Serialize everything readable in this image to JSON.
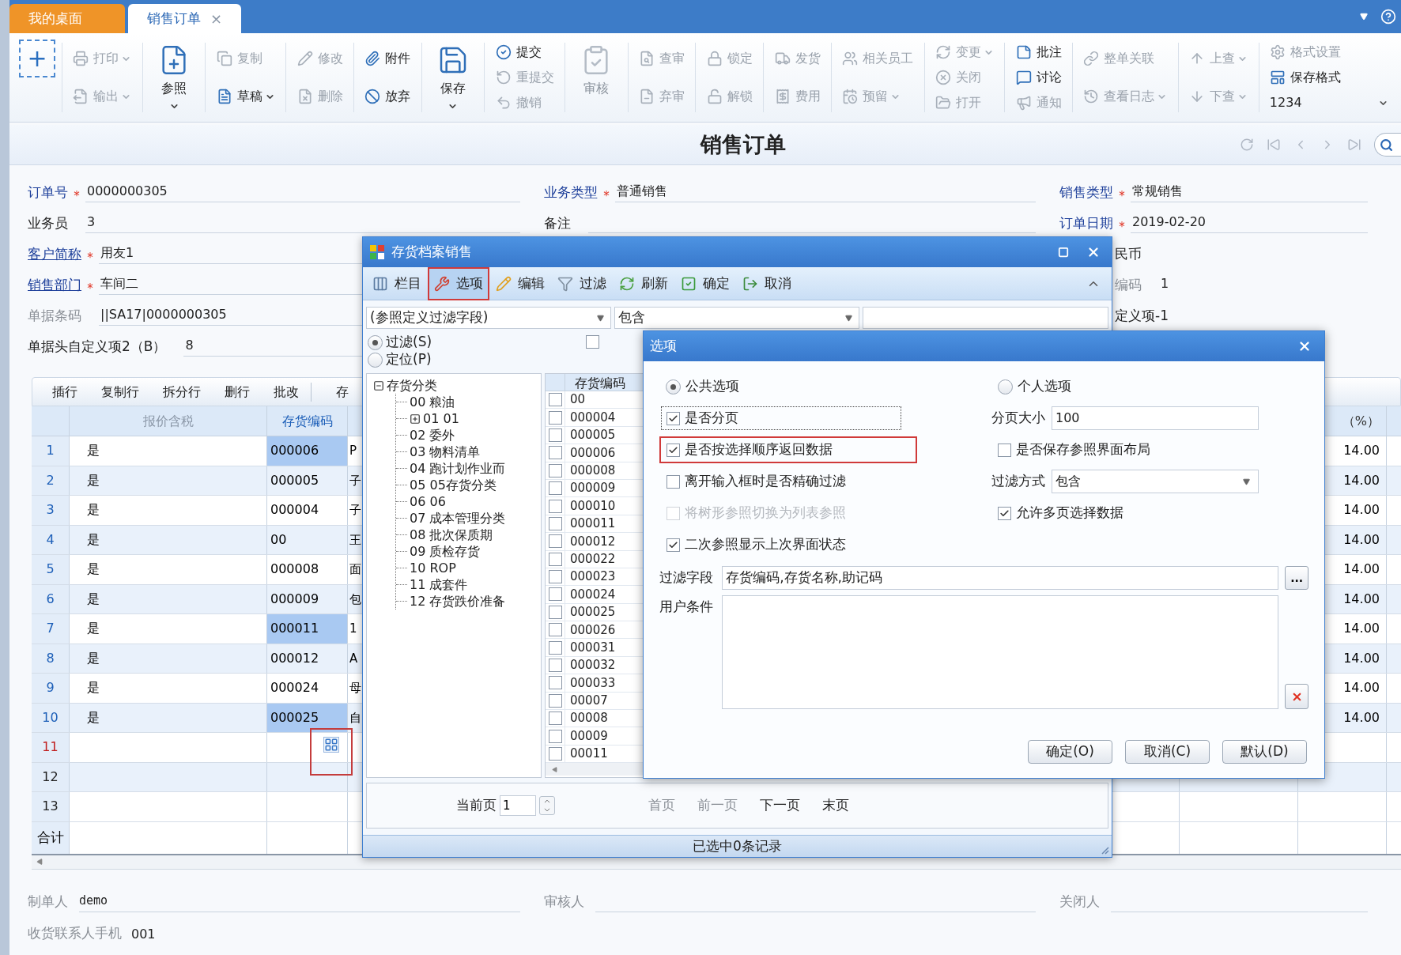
{
  "app_tabs": [
    {
      "label": "我的桌面",
      "selected": false
    },
    {
      "label": "销售订单",
      "selected": true,
      "close": "×"
    }
  ],
  "toolbar": {
    "add": "+",
    "columns": [
      {
        "kind": "stack",
        "items": [
          {
            "label": "打印",
            "disabled": true,
            "dropdown": true
          },
          {
            "label": "输出",
            "disabled": true,
            "dropdown": true
          }
        ]
      },
      {
        "kind": "large",
        "items": [
          {
            "label": "参照",
            "disabled": false,
            "dropdown": true
          }
        ]
      },
      {
        "kind": "stack",
        "items": [
          {
            "label": "复制",
            "disabled": true,
            "dropdown": false
          },
          {
            "label": "草稿",
            "disabled": false,
            "dropdown": true
          }
        ]
      },
      {
        "kind": "stack",
        "items": [
          {
            "label": "修改",
            "disabled": true,
            "dropdown": false
          },
          {
            "label": "删除",
            "disabled": true,
            "dropdown": false
          }
        ]
      },
      {
        "kind": "stack",
        "items": [
          {
            "label": "附件",
            "disabled": false,
            "dropdown": false
          },
          {
            "label": "放弃",
            "disabled": false,
            "dropdown": false
          }
        ]
      },
      {
        "kind": "large",
        "items": [
          {
            "label": "保存",
            "disabled": false,
            "dropdown": true
          }
        ]
      },
      {
        "kind": "stack",
        "items": [
          {
            "label": "提交",
            "disabled": false,
            "dropdown": false
          },
          {
            "label": "重提交",
            "disabled": true,
            "dropdown": false
          },
          {
            "label": "撤销",
            "disabled": true,
            "dropdown": false
          }
        ]
      },
      {
        "kind": "large",
        "items": [
          {
            "label": "审核",
            "disabled": true,
            "dropdown": false
          }
        ]
      },
      {
        "kind": "stack",
        "items": [
          {
            "label": "查审",
            "disabled": true,
            "dropdown": false
          },
          {
            "label": "弃审",
            "disabled": true,
            "dropdown": false
          }
        ]
      },
      {
        "kind": "stack",
        "items": [
          {
            "label": "锁定",
            "disabled": true,
            "dropdown": false
          },
          {
            "label": "解锁",
            "disabled": true,
            "dropdown": false
          }
        ]
      },
      {
        "kind": "stack",
        "items": [
          {
            "label": "发货",
            "disabled": true,
            "dropdown": false
          },
          {
            "label": "费用",
            "disabled": true,
            "dropdown": false
          }
        ]
      },
      {
        "kind": "stack",
        "items": [
          {
            "label": "相关员工",
            "disabled": true,
            "dropdown": false
          },
          {
            "label": "预留",
            "disabled": true,
            "dropdown": true
          }
        ]
      },
      {
        "kind": "stack",
        "items": [
          {
            "label": "变更",
            "disabled": true,
            "dropdown": true
          },
          {
            "label": "关闭",
            "disabled": true,
            "dropdown": false
          },
          {
            "label": "打开",
            "disabled": true,
            "dropdown": false
          }
        ]
      },
      {
        "kind": "stack",
        "items": [
          {
            "label": "批注",
            "disabled": false,
            "dropdown": false
          },
          {
            "label": "讨论",
            "disabled": false,
            "dropdown": false
          },
          {
            "label": "通知",
            "disabled": true,
            "dropdown": false
          }
        ]
      },
      {
        "kind": "stack",
        "items": [
          {
            "label": "整单关联",
            "disabled": true,
            "dropdown": false
          },
          {
            "label": "查看日志",
            "disabled": true,
            "dropdown": true
          }
        ]
      },
      {
        "kind": "stack",
        "items": [
          {
            "label": "上查",
            "disabled": true,
            "dropdown": true
          },
          {
            "label": "下查",
            "disabled": true,
            "dropdown": true
          }
        ]
      },
      {
        "kind": "stack",
        "items": [
          {
            "label": "格式设置",
            "disabled": true,
            "dropdown": false
          },
          {
            "label": "保存格式",
            "disabled": false,
            "dropdown": false
          }
        ],
        "select": {
          "value": "1234"
        }
      }
    ]
  },
  "page_title": "销售订单",
  "form": {
    "rows": [
      {
        "left": {
          "label": "订单号",
          "color": "#1d3f9a",
          "link": false,
          "required_mark": "*",
          "value": "0000000305"
        },
        "middle": {
          "label": "业务类型",
          "color": "#1d3f9a",
          "link": false,
          "required_mark": "*",
          "value": "普通销售"
        },
        "right": {
          "label": "销售类型",
          "color": "#1d3f9a",
          "link": false,
          "required_mark": "*",
          "value": "常规销售"
        }
      },
      {
        "left": {
          "label": "业务员",
          "color": "#222222",
          "link": false,
          "value": "3"
        },
        "middle": {
          "label": "备注",
          "color": "#222222",
          "link": false
        },
        "right": {
          "label": "订单日期",
          "color": "#1d3f9a",
          "link": false,
          "required_mark": "*",
          "value": "2019-02-20"
        }
      },
      {
        "left": {
          "label": "客户简称",
          "color": "#1d3f9a",
          "link": true,
          "required_mark": "*",
          "value": "用友1"
        },
        "right": {
          "label": "民币",
          "color": "#222222",
          "link": false,
          "cut": true
        }
      },
      {
        "left": {
          "label": "销售部门",
          "color": "#1d3f9a",
          "link": true,
          "required_mark": "*",
          "value": "车间二"
        },
        "right": {
          "label": "编码",
          "color": "#8a8f96",
          "link": false,
          "value": "1",
          "cut": true
        }
      },
      {
        "left": {
          "label": "单据条码",
          "color": "#8a8f96",
          "link": false,
          "value": "||SA17|0000000305"
        },
        "right": {
          "label": "定义项-1",
          "color": "#222222",
          "link": false,
          "cut": true
        }
      },
      {
        "left": {
          "label": "单据头自定义项2（B）",
          "color": "#222222",
          "link": false,
          "value": "8"
        }
      }
    ]
  },
  "grid": {
    "toolbar": [
      "插行",
      "复制行",
      "拆分行",
      "删行",
      "批改",
      "存"
    ],
    "columns": [
      {
        "label": "报价含税",
        "kind": "readonly"
      },
      {
        "label": "存货编码",
        "kind": "reference"
      },
      {
        "label": "（%）",
        "kind": "normal"
      }
    ],
    "rows": [
      {
        "number": "1",
        "kind": "filled",
        "quote": "是",
        "code": "000006",
        "selected": true,
        "name": "P",
        "rate": "14.00"
      },
      {
        "number": "2",
        "kind": "filled",
        "quote": "是",
        "code": "000005",
        "selected": false,
        "name": "子",
        "rate": "14.00"
      },
      {
        "number": "3",
        "kind": "filled",
        "quote": "是",
        "code": "000004",
        "selected": false,
        "name": "子",
        "rate": "14.00"
      },
      {
        "number": "4",
        "kind": "filled",
        "quote": "是",
        "code": "00",
        "selected": false,
        "name": "王",
        "rate": "14.00"
      },
      {
        "number": "5",
        "kind": "filled",
        "quote": "是",
        "code": "000008",
        "selected": false,
        "name": "面",
        "rate": "14.00"
      },
      {
        "number": "6",
        "kind": "filled",
        "quote": "是",
        "code": "000009",
        "selected": false,
        "name": "包",
        "rate": "14.00"
      },
      {
        "number": "7",
        "kind": "filled",
        "quote": "是",
        "code": "000011",
        "selected": true,
        "name": "1",
        "rate": "14.00"
      },
      {
        "number": "8",
        "kind": "filled",
        "quote": "是",
        "code": "000012",
        "selected": false,
        "name": "A",
        "rate": "14.00"
      },
      {
        "number": "9",
        "kind": "filled",
        "quote": "是",
        "code": "000024",
        "selected": false,
        "name": "母",
        "rate": "14.00"
      },
      {
        "number": "10",
        "kind": "filled",
        "quote": "是",
        "code": "000025",
        "selected": true,
        "name": "自",
        "rate": "14.00"
      },
      {
        "number": "11",
        "kind": "current"
      },
      {
        "number": "12",
        "kind": "empty"
      },
      {
        "number": "13",
        "kind": "empty"
      }
    ],
    "reference_button": {
      "highlighted": true
    },
    "total_label": "合计"
  },
  "footer": {
    "fields": [
      {
        "label": "制单人",
        "value": "demo"
      },
      {
        "label": "审核人"
      },
      {
        "label": "关闭人"
      }
    ],
    "contact": {
      "label": "收货联系人手机",
      "value": "001"
    }
  },
  "reference_dialog": {
    "title": "存货档案销售",
    "toolbar": [
      {
        "label": "栏目",
        "selected": false,
        "highlighted": false
      },
      {
        "label": "选项",
        "selected": true,
        "highlighted": true
      },
      {
        "label": "编辑",
        "selected": false,
        "highlighted": false
      },
      {
        "label": "过滤",
        "selected": false,
        "highlighted": false
      },
      {
        "label": "刷新",
        "selected": false,
        "highlighted": false
      },
      {
        "label": "确定",
        "selected": false,
        "highlighted": false
      },
      {
        "label": "取消",
        "selected": false,
        "highlighted": false
      }
    ],
    "filter": {
      "field": "(参照定义过滤字段)",
      "operator": "包含"
    },
    "modes": [
      {
        "label": "过滤(S)",
        "selected": true
      },
      {
        "label": "定位(P)",
        "selected": false
      }
    ],
    "extra_check": {
      "checked": false
    },
    "tree": {
      "label": "存货分类",
      "expanded": true,
      "children": [
        {
          "label": "00 粮油"
        },
        {
          "label": "01 01",
          "expanded": false
        },
        {
          "label": "02 委外"
        },
        {
          "label": "03 物料清单"
        },
        {
          "label": "04 跑计划作业而"
        },
        {
          "label": "05 05存货分类"
        },
        {
          "label": "06 06"
        },
        {
          "label": "07 成本管理分类"
        },
        {
          "label": "08 批次保质期"
        },
        {
          "label": "09 质检存货"
        },
        {
          "label": "10 ROP"
        },
        {
          "label": "11 成套件"
        },
        {
          "label": "12 存货跌价准备"
        }
      ]
    },
    "list": {
      "header": "存货编码",
      "rows": [
        {
          "code": "00",
          "checked": false
        },
        {
          "code": "000004",
          "checked": false
        },
        {
          "code": "000005",
          "checked": false
        },
        {
          "code": "000006",
          "checked": false
        },
        {
          "code": "000008",
          "checked": false
        },
        {
          "code": "000009",
          "checked": false
        },
        {
          "code": "000010",
          "checked": false
        },
        {
          "code": "000011",
          "checked": false
        },
        {
          "code": "000012",
          "checked": false
        },
        {
          "code": "000022",
          "checked": false
        },
        {
          "code": "000023",
          "checked": false
        },
        {
          "code": "000024",
          "checked": false
        },
        {
          "code": "000025",
          "checked": false
        },
        {
          "code": "000026",
          "checked": false
        },
        {
          "code": "000031",
          "checked": false
        },
        {
          "code": "000032",
          "checked": false
        },
        {
          "code": "000033",
          "checked": false
        },
        {
          "code": "00007",
          "checked": false
        },
        {
          "code": "00008",
          "checked": false
        },
        {
          "code": "00009",
          "checked": false
        },
        {
          "code": "00011",
          "checked": false
        }
      ]
    },
    "pager": {
      "label": "当前页",
      "page": "1",
      "links": [
        {
          "label": "首页",
          "disabled": true
        },
        {
          "label": "前一页",
          "disabled": true
        },
        {
          "label": "下一页",
          "disabled": false
        },
        {
          "label": "末页",
          "disabled": false
        }
      ]
    },
    "status": "已选中0条记录"
  },
  "options_dialog": {
    "title": "选项",
    "scopes": [
      {
        "label": "公共选项",
        "selected": true
      },
      {
        "label": "个人选项",
        "selected": false
      }
    ],
    "left": [
      {
        "label": "是否分页",
        "checked": true,
        "disabled": false,
        "focused": true,
        "highlighted": false
      },
      {
        "label": "是否按选择顺序返回数据",
        "checked": true,
        "disabled": false,
        "focused": false,
        "highlighted": true
      },
      {
        "label": "离开输入框时是否精确过滤",
        "checked": false,
        "disabled": false,
        "focused": false,
        "highlighted": false
      },
      {
        "label": "将树形参照切换为列表参照",
        "checked": false,
        "disabled": true,
        "focused": false,
        "highlighted": false
      },
      {
        "label": "二次参照显示上次界面状态",
        "checked": true,
        "disabled": false,
        "focused": false,
        "highlighted": false
      }
    ],
    "right": [
      {
        "kind": "field",
        "label": "分页大小",
        "value": "100"
      },
      {
        "kind": "check",
        "label": "是否保存参照界面布局",
        "checked": false
      },
      {
        "kind": "select",
        "label": "过滤方式",
        "value": "包含"
      },
      {
        "kind": "check",
        "label": "允许多页选择数据",
        "checked": true
      }
    ],
    "filter_fields": {
      "label": "过滤字段",
      "value": "存货编码,存货名称,助记码",
      "more": "..."
    },
    "user_condition": {
      "label": "用户条件"
    },
    "buttons": [
      "确定(O)",
      "取消(C)",
      "默认(D)"
    ]
  }
}
